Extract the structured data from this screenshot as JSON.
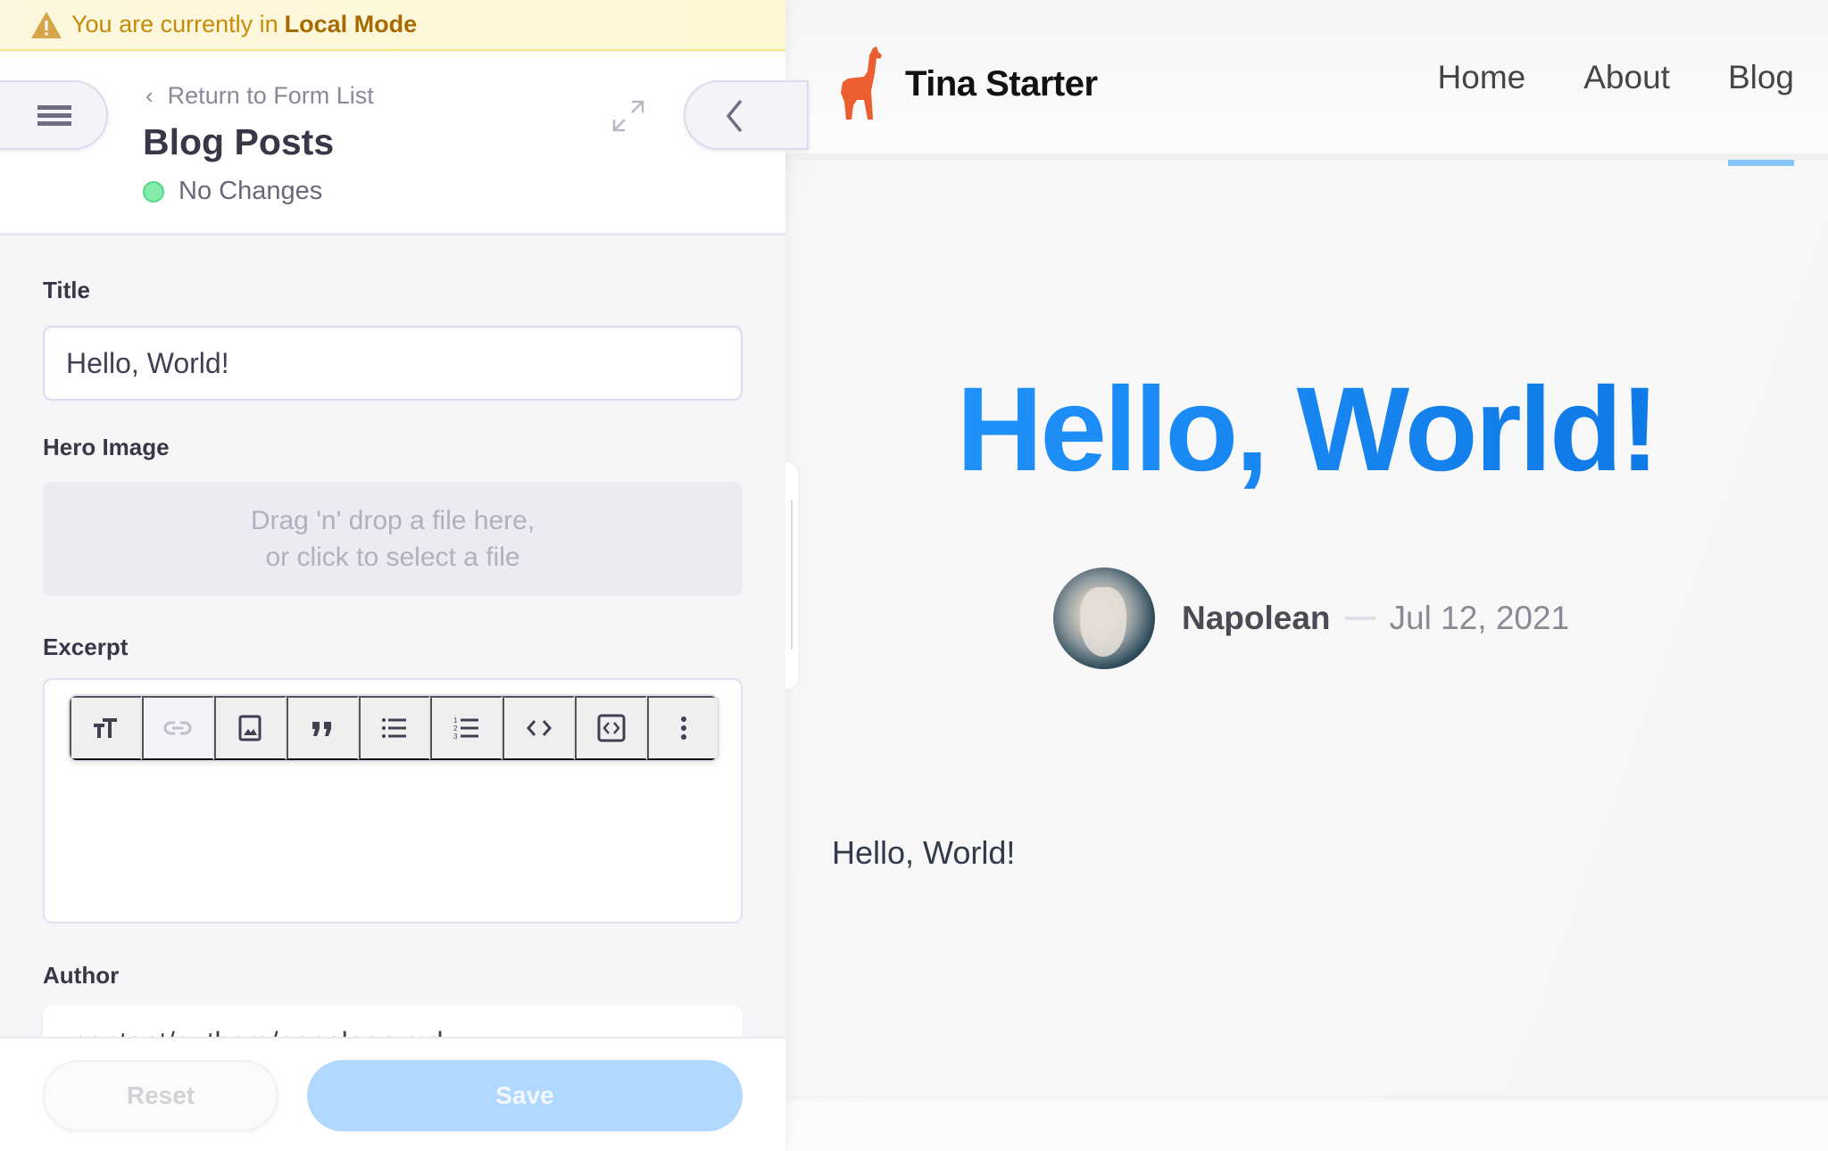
{
  "banner": {
    "icon": "warning-icon",
    "text": "You are currently in",
    "mode": "Local Mode",
    "color": "#c58c0a"
  },
  "form_header": {
    "menu_icon": "hamburger-icon",
    "return_label": "Return to Form List",
    "title": "Blog Posts",
    "status": "No Changes",
    "status_color": "#84ebaa",
    "expand_icon": "expand-icon",
    "collapse_icon": "chevron-left-icon"
  },
  "fields": {
    "title": {
      "label": "Title",
      "value": "Hello, World!"
    },
    "hero_image": {
      "label": "Hero Image",
      "dropzone_line1": "Drag 'n' drop a file here,",
      "dropzone_line2": "or click to select a file"
    },
    "excerpt": {
      "label": "Excerpt",
      "toolbar": [
        {
          "icon": "text-size-icon",
          "disabled": false
        },
        {
          "icon": "link-icon",
          "disabled": true
        },
        {
          "icon": "image-icon",
          "disabled": false
        },
        {
          "icon": "quote-icon",
          "disabled": false
        },
        {
          "icon": "bulleted-list-icon",
          "disabled": false
        },
        {
          "icon": "numbered-list-icon",
          "disabled": false
        },
        {
          "icon": "code-icon",
          "disabled": false
        },
        {
          "icon": "code-block-icon",
          "disabled": false
        },
        {
          "icon": "more-vertical-icon",
          "disabled": false
        }
      ],
      "value": ""
    },
    "author": {
      "label": "Author",
      "value": "content/authors/napolean.md"
    }
  },
  "footer": {
    "reset_label": "Reset",
    "save_label": "Save",
    "save_color": "#b1d8fd"
  },
  "site": {
    "name": "Tina Starter",
    "logo_icon": "llama-logo-icon",
    "logo_color": "#eb5e30",
    "nav": [
      {
        "label": "Home",
        "active": false
      },
      {
        "label": "About",
        "active": false
      },
      {
        "label": "Blog",
        "active": true
      }
    ],
    "post": {
      "title": "Hello, World!",
      "title_gradient": [
        "#2497ff",
        "#0b74e2"
      ],
      "author": "Napolean",
      "date": "Jul 12, 2021",
      "body": "Hello, World!"
    }
  }
}
